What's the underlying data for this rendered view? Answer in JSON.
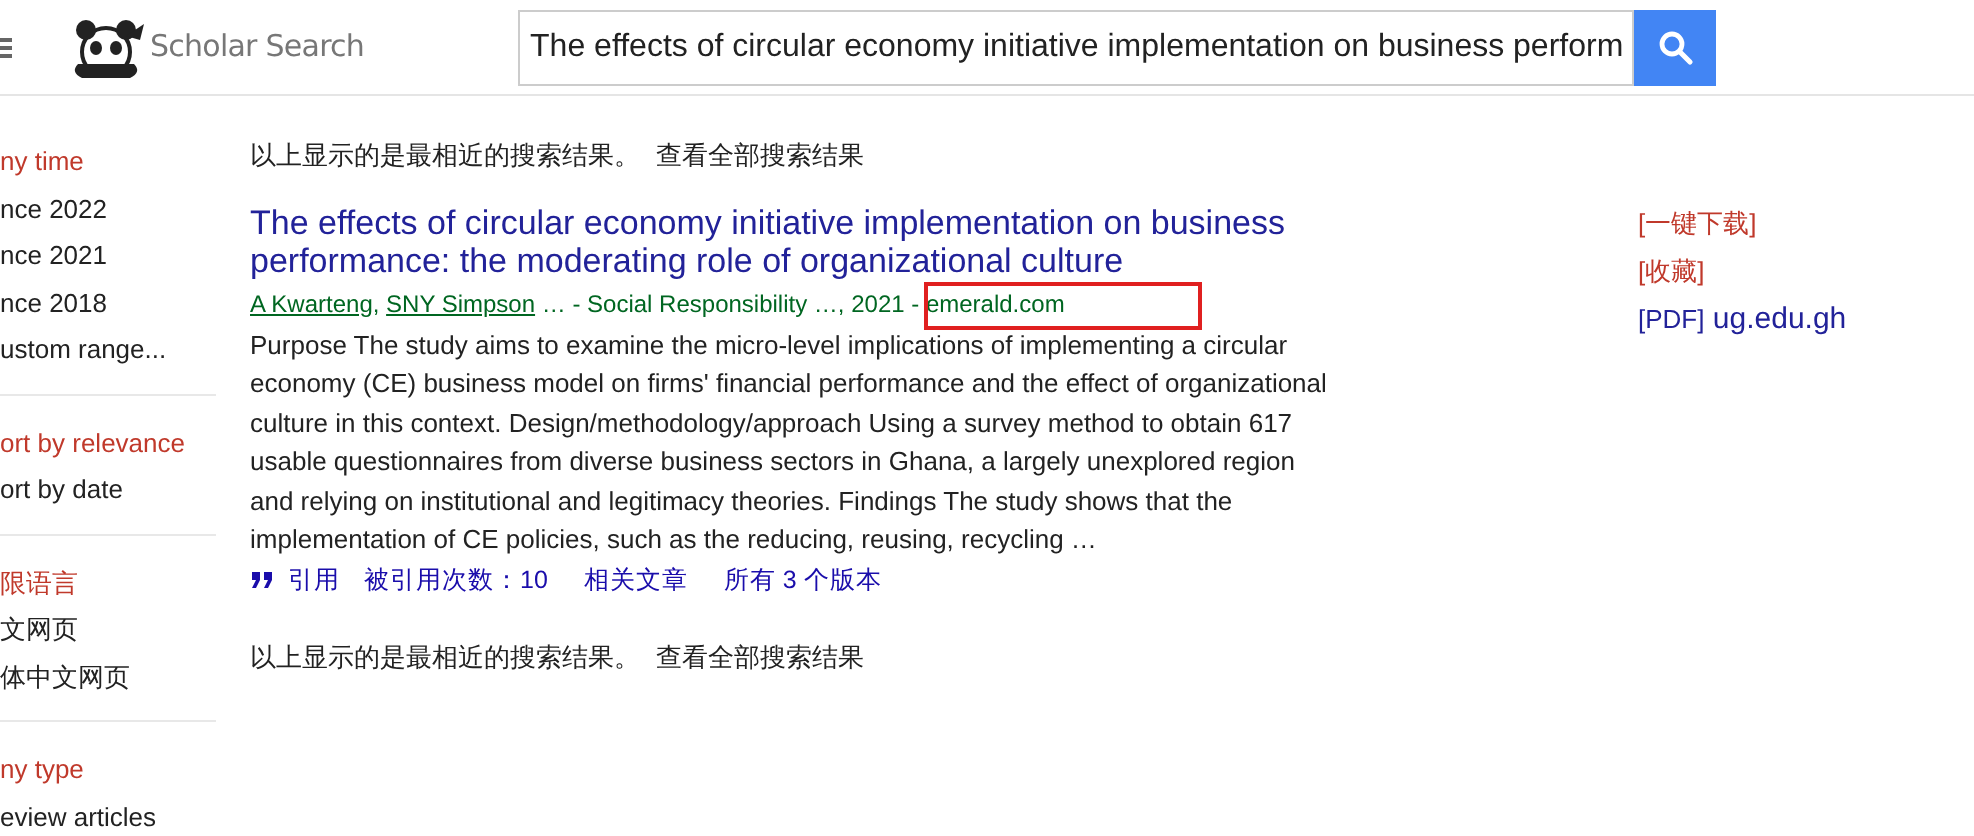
{
  "header": {
    "logo_text": "Scholar Search",
    "search": {
      "value": "The effects of circular economy initiative implementation on business perform"
    }
  },
  "sidebar": {
    "groups": [
      {
        "items": [
          {
            "label": "ny time",
            "selected": true
          },
          {
            "label": "nce 2022",
            "selected": false
          },
          {
            "label": "nce 2021",
            "selected": false
          },
          {
            "label": "nce 2018",
            "selected": false
          },
          {
            "label": "ustom range...",
            "selected": false
          }
        ]
      },
      {
        "items": [
          {
            "label": "ort by relevance",
            "selected": true
          },
          {
            "label": "ort by date",
            "selected": false
          }
        ]
      },
      {
        "items": [
          {
            "label": "限语言",
            "selected": true
          },
          {
            "label": "文网页",
            "selected": false
          },
          {
            "label": "体中文网页",
            "selected": false
          }
        ]
      },
      {
        "items": [
          {
            "label": "ny type",
            "selected": true
          },
          {
            "label": "eview articles",
            "selected": false
          }
        ]
      }
    ]
  },
  "notice_top": {
    "text": "以上显示的是最相近的搜索结果。",
    "link": "查看全部搜索结果"
  },
  "result": {
    "title": "The effects of circular economy initiative implementation on business performance: the moderating role of organizational culture",
    "authors": [
      "A Kwarteng",
      "SNY Simpson"
    ],
    "author_separator": ", ",
    "meta": "… - Social Responsibility …, 2021 - emerald.com",
    "snippet": "Purpose The study aims to examine the micro-level implications of implementing a circular economy (CE) business model on firms' financial performance and the effect of organizational culture in this context. Design/methodology/approach Using a survey method to obtain 617 usable questionnaires from diverse business sectors in Ghana, a largely unexplored region and relying on institutional and legitimacy theories. Findings The study shows that the implementation of CE policies, such as the reducing, reusing, recycling …",
    "actions": [
      "引用",
      "被引用次数：10",
      "相关文章",
      "所有 3 个版本"
    ],
    "side_links": [
      {
        "kind": "tool",
        "text": "[一键下载]"
      },
      {
        "kind": "tool",
        "text": "[收藏]"
      },
      {
        "kind": "pdf",
        "tag": "[PDF]",
        "text": "ug.edu.gh"
      }
    ]
  },
  "notice_bottom": {
    "text": "以上显示的是最相近的搜索结果。",
    "link": "查看全部搜索结果"
  }
}
